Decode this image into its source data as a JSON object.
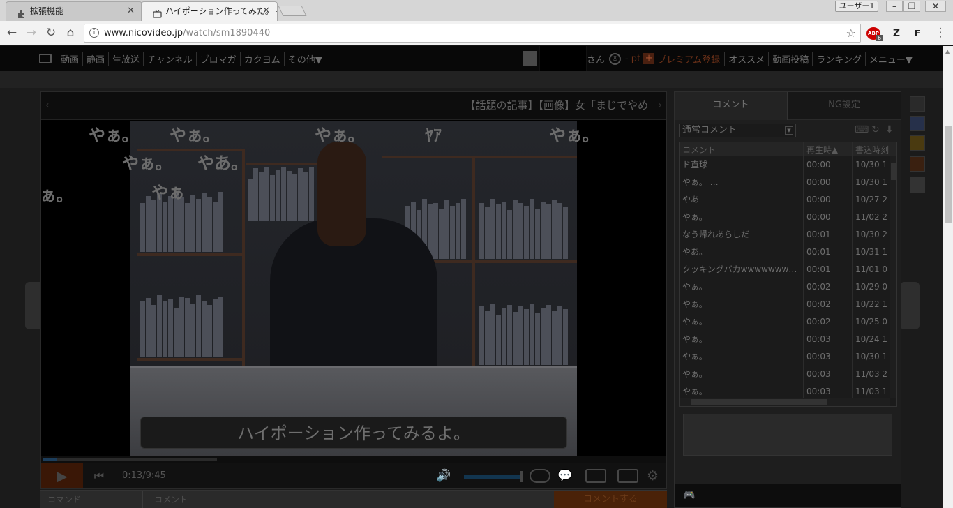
{
  "browser": {
    "tabs": [
      {
        "title": "拡張機能"
      },
      {
        "title": "ハイポーション作ってみた。 -"
      }
    ],
    "profile": "ユーザー1",
    "url_host": "www.nicovideo.jp",
    "url_path": "/watch/sm1890440",
    "extensions": [
      "ABP",
      "Z",
      "F"
    ],
    "abp_badge": "6"
  },
  "site_nav": {
    "left": [
      "動画",
      "静画",
      "生放送",
      "チャンネル",
      "ブロマガ",
      "カクヨム",
      "その他▼"
    ],
    "san": "さん",
    "points_sep": "-",
    "points_unit": "pt",
    "premium": "プレミアム登録",
    "right": [
      "オススメ",
      "動画投稿",
      "ランキング",
      "メニュー▼"
    ]
  },
  "player": {
    "marquee": "【話題の記事】【画像】女「まじでやめ",
    "subtitle": "ハイポーション作ってみるよ。",
    "comments": [
      "やぁ。",
      "やぁ。",
      "やぁ。",
      "ﾔｱ",
      "やぁ。",
      "やぁ。",
      "やあ。",
      "やぁ",
      "ぁ。"
    ],
    "time": "0:13/9:45",
    "progress_fraction": 0.023,
    "buffered_fraction": 0.28,
    "volume_fraction": 0.98
  },
  "comment_bar": {
    "command_placeholder": "コマンド",
    "comment_placeholder": "コメント",
    "submit": "コメントする"
  },
  "comment_panel": {
    "tabs": [
      "コメント",
      "NG設定"
    ],
    "filter": "通常コメント",
    "headers": [
      "コメント",
      "再生時▲",
      "書込時刻"
    ],
    "rows": [
      {
        "text": "ド直球",
        "time": "00:00",
        "date": "10/30 1"
      },
      {
        "text": "やぁ。                   …",
        "time": "00:00",
        "date": "10/30 1"
      },
      {
        "text": "やあ",
        "time": "00:00",
        "date": "10/27 2"
      },
      {
        "text": "やぁ。",
        "time": "00:00",
        "date": "11/02 2"
      },
      {
        "text": "なう帰れあらしだ",
        "time": "00:01",
        "date": "10/30 2"
      },
      {
        "text": "やあ。",
        "time": "00:01",
        "date": "10/31 1"
      },
      {
        "text": "クッキングバカwwwwwww…",
        "time": "00:01",
        "date": "11/01 0"
      },
      {
        "text": "やぁ。",
        "time": "00:02",
        "date": "10/29 0"
      },
      {
        "text": "やぁ。",
        "time": "00:02",
        "date": "10/22 1"
      },
      {
        "text": "やぁ。",
        "time": "00:02",
        "date": "10/25 0"
      },
      {
        "text": "やぁ。",
        "time": "00:03",
        "date": "10/24 1"
      },
      {
        "text": "やぁ。",
        "time": "00:03",
        "date": "10/30 1"
      },
      {
        "text": "やぁ。",
        "time": "00:03",
        "date": "11/03 2"
      },
      {
        "text": "やぁ。",
        "time": "00:03",
        "date": "11/03 1"
      }
    ]
  }
}
